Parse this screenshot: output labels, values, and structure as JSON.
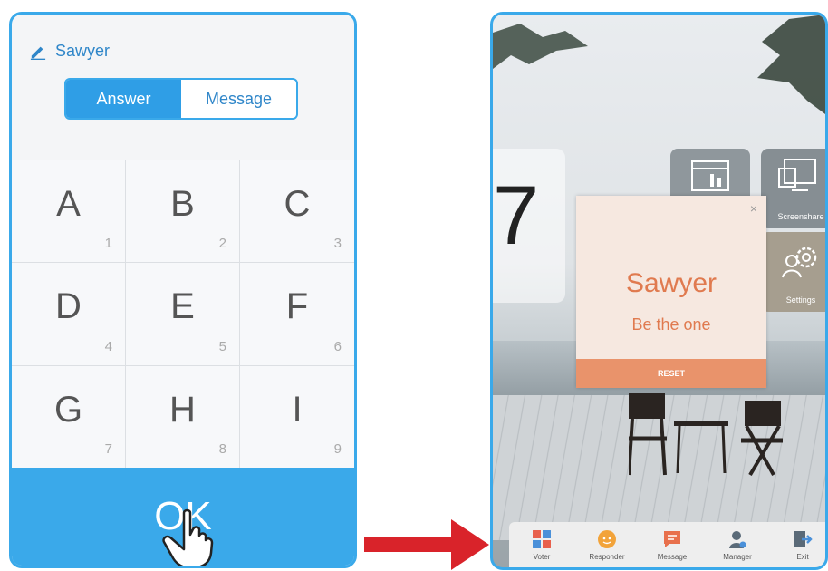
{
  "phone": {
    "user_name": "Sawyer",
    "tabs": [
      {
        "label": "Answer",
        "active": true
      },
      {
        "label": "Message",
        "active": false
      }
    ],
    "keys": [
      {
        "letter": "A",
        "num": "1"
      },
      {
        "letter": "B",
        "num": "2"
      },
      {
        "letter": "C",
        "num": "3"
      },
      {
        "letter": "D",
        "num": "4"
      },
      {
        "letter": "E",
        "num": "5"
      },
      {
        "letter": "F",
        "num": "6"
      },
      {
        "letter": "G",
        "num": "7"
      },
      {
        "letter": "H",
        "num": "8"
      },
      {
        "letter": "I",
        "num": "9"
      }
    ],
    "ok_label": "OK",
    "accent": "#3aa9ea"
  },
  "arrow_color": "#d9232a",
  "tablet": {
    "clock_digit": "7",
    "tiles": {
      "screenshare": "Screenshare",
      "settings": "Settings"
    },
    "popup": {
      "close": "×",
      "name": "Sawyer",
      "slogan": "Be the one",
      "reset": "RESET",
      "accent": "#e07a4f"
    },
    "taskbar": [
      {
        "label": "Voter",
        "icon": "voter-icon"
      },
      {
        "label": "Responder",
        "icon": "responder-icon"
      },
      {
        "label": "Message",
        "icon": "message-icon"
      },
      {
        "label": "Manager",
        "icon": "manager-icon"
      },
      {
        "label": "Exit",
        "icon": "exit-icon"
      }
    ]
  }
}
